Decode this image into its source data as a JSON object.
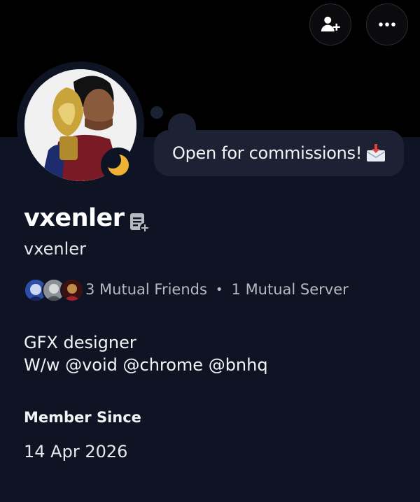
{
  "header": {
    "add_friend_icon": "add-friend-icon",
    "more_icon": "more-options-icon"
  },
  "avatar": {
    "status": "idle"
  },
  "custom_status": {
    "text": "Open for commissions!",
    "emoji_icon": "envelope-inbox-icon"
  },
  "profile": {
    "display_name": "vxenler",
    "username": "vxenler",
    "note_icon": "note-icon"
  },
  "mutuals": {
    "friends": "3 Mutual Friends",
    "separator": "•",
    "servers": "1 Mutual Server"
  },
  "bio": {
    "line1": "GFX designer",
    "line2": "W/w @void @chrome @bnhq"
  },
  "member_since": {
    "label": "Member Since",
    "date": "14 Apr 2026"
  },
  "colors": {
    "background": "#0f1424",
    "banner": "#000000",
    "bubble": "#1c2233",
    "idle": "#f0b232",
    "muted_text": "#b5bac1"
  }
}
